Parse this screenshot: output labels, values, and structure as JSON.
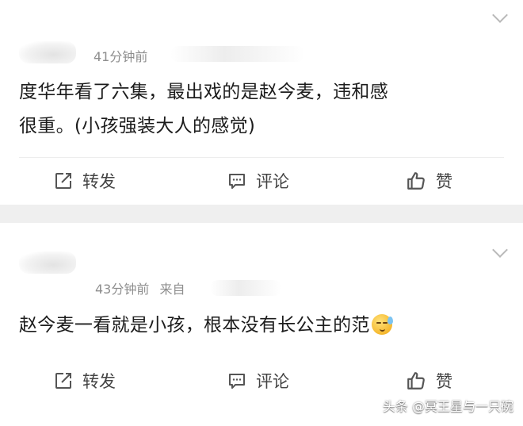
{
  "comments": [
    {
      "time": "41分钟前",
      "text_line1": "度华年看了六集，最出戏的是赵今麦，违和感",
      "text_line2": "很重。(小孩强装大人的感觉)",
      "actions": {
        "repost": "转发",
        "comment": "评论",
        "like": "赞"
      }
    },
    {
      "time": "43分钟前",
      "source": "来自",
      "text": "赵今麦一看就是小孩，根本没有长公主的范",
      "emoji": "sleepy-sweat-face",
      "actions": {
        "repost": "转发",
        "comment": "评论",
        "like": "赞"
      }
    }
  ],
  "watermark": "头条 @冥王星与一只碗"
}
